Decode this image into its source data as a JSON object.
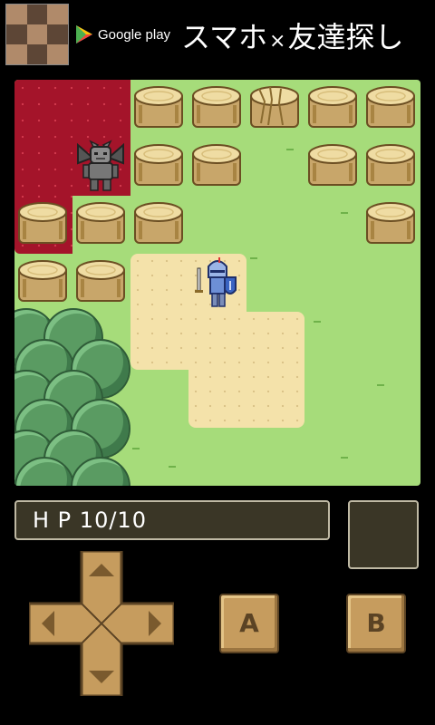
{
  "ad": {
    "store_label": "Google play",
    "title_part1": "スマホ",
    "title_sep": "×",
    "title_part2": "友達探し"
  },
  "status": {
    "hp_label": "H P",
    "hp_value": "10/10"
  },
  "controls": {
    "a_label": "A",
    "b_label": "B"
  },
  "colors": {
    "grass": "#a6dc7a",
    "lava": "#a4142a",
    "sand": "#f4e2aa",
    "panel": "#3a3626",
    "button": "#c69c5e"
  }
}
